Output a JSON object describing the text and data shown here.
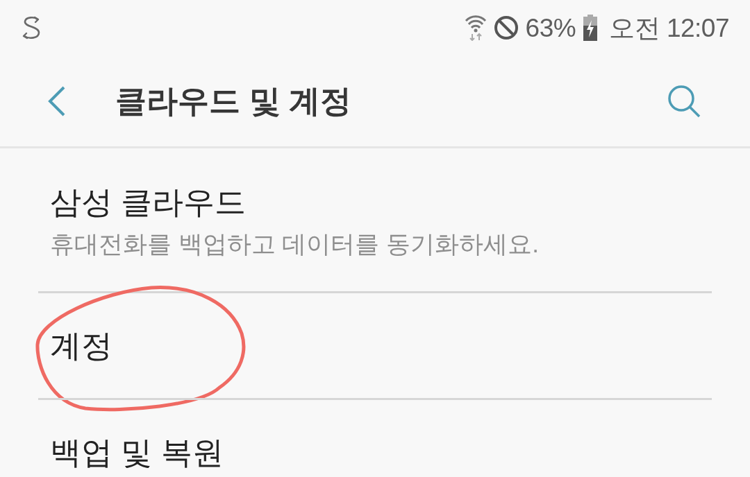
{
  "status_bar": {
    "battery_text": "63%",
    "time": "오전 12:07"
  },
  "header": {
    "title": "클라우드 및 계정"
  },
  "items": [
    {
      "title": "삼성 클라우드",
      "subtitle": "휴대전화를 백업하고 데이터를 동기화하세요.",
      "circled": false
    },
    {
      "title": "계정",
      "circled": true
    },
    {
      "title": "백업 및 복원",
      "circled": false
    }
  ]
}
